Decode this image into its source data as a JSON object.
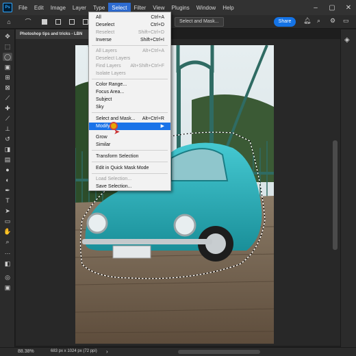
{
  "app": {
    "logo": "Ps"
  },
  "menubar": {
    "items": [
      "File",
      "Edit",
      "Image",
      "Layer",
      "Type",
      "Select",
      "Filter",
      "View",
      "Plugins",
      "Window",
      "Help"
    ],
    "active": "Select"
  },
  "options": {
    "select_and_mask": "Select and Mask...",
    "share": "Share"
  },
  "document": {
    "tab_title": "Photoshop tips and tricks - LBN",
    "zoom": "88.38%",
    "info": "683 px x 1024 px (72 ppi)"
  },
  "select_menu": {
    "all": {
      "label": "All",
      "shortcut": "Ctrl+A"
    },
    "deselect": {
      "label": "Deselect",
      "shortcut": "Ctrl+D"
    },
    "reselect": {
      "label": "Reselect",
      "shortcut": "Shift+Ctrl+D"
    },
    "inverse": {
      "label": "Inverse",
      "shortcut": "Shift+Ctrl+I"
    },
    "all_layers": {
      "label": "All Layers",
      "shortcut": "Alt+Ctrl+A"
    },
    "deselect_layers": {
      "label": "Deselect Layers",
      "shortcut": ""
    },
    "find_layers": {
      "label": "Find Layers",
      "shortcut": "Alt+Shift+Ctrl+F"
    },
    "isolate_layers": {
      "label": "Isolate Layers",
      "shortcut": ""
    },
    "color_range": {
      "label": "Color Range...",
      "shortcut": ""
    },
    "focus_area": {
      "label": "Focus Area...",
      "shortcut": ""
    },
    "subject": {
      "label": "Subject",
      "shortcut": ""
    },
    "sky": {
      "label": "Sky",
      "shortcut": ""
    },
    "select_and_mask": {
      "label": "Select and Mask...",
      "shortcut": "Alt+Ctrl+R"
    },
    "modify": {
      "label": "Modify",
      "shortcut": ""
    },
    "grow": {
      "label": "Grow",
      "shortcut": ""
    },
    "similar": {
      "label": "Similar",
      "shortcut": ""
    },
    "transform_selection": {
      "label": "Transform Selection",
      "shortcut": ""
    },
    "quick_mask": {
      "label": "Edit in Quick Mask Mode",
      "shortcut": ""
    },
    "load_selection": {
      "label": "Load Selection...",
      "shortcut": ""
    },
    "save_selection": {
      "label": "Save Selection...",
      "shortcut": ""
    }
  },
  "colors": {
    "accent": "#1a73e8",
    "car": "#2bb5bf",
    "sky": "#d8e4e6"
  }
}
